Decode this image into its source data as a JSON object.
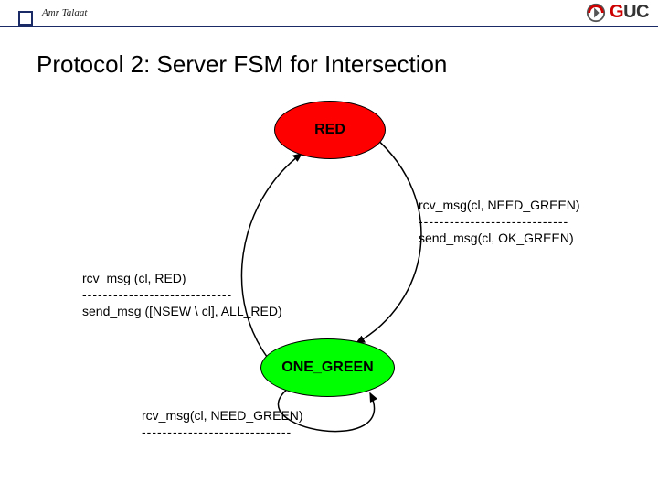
{
  "header": {
    "author": "Amr Talaat",
    "logo_letters": {
      "g": "G",
      "uc": "UC"
    }
  },
  "title": "Protocol 2: Server FSM for Intersection",
  "fsm": {
    "states": {
      "red": {
        "label": "RED"
      },
      "green": {
        "label": "ONE_GREEN"
      }
    },
    "transitions": {
      "red_to_green": {
        "guard": "rcv_msg(cl, NEED_GREEN)",
        "rule": "-----------------------------",
        "action": "send_msg(cl, OK_GREEN)"
      },
      "green_to_red": {
        "guard": "rcv_msg (cl, RED)",
        "rule": "-----------------------------",
        "action": "send_msg ([NSEW \\ cl], ALL_RED)"
      },
      "green_self": {
        "guard": "rcv_msg(cl, NEED_GREEN)",
        "rule": "-----------------------------",
        "action": ""
      }
    }
  }
}
